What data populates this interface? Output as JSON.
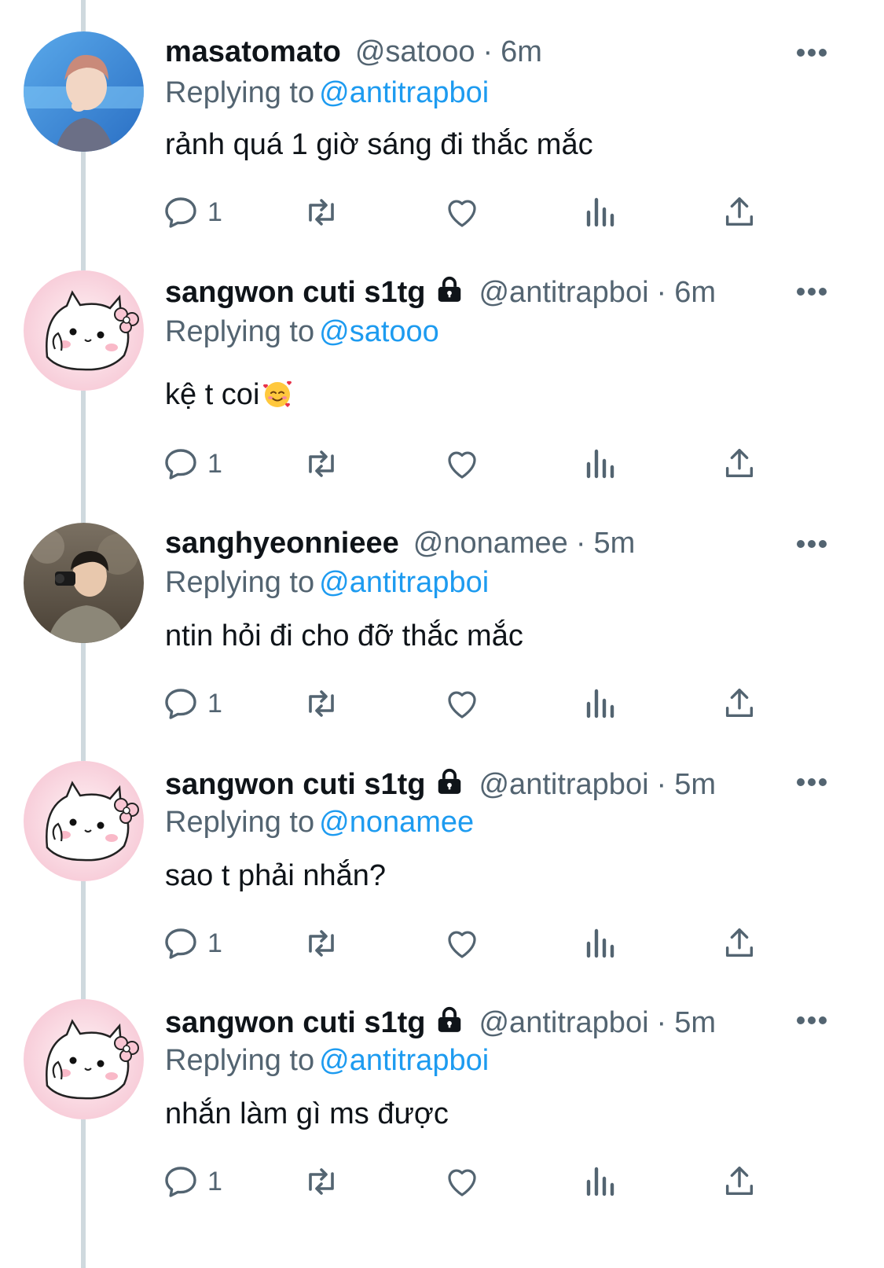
{
  "tweets": [
    {
      "display_name": "masatomato",
      "locked": false,
      "handle": "@satooo",
      "time": "6m",
      "replying_label": "Replying to",
      "reply_to": "@antitrapboi",
      "text": "rảnh quá 1 giờ sáng đi thắc mắc",
      "emoji": "",
      "avatar": "photo-avatar-blue",
      "reply_count": "1"
    },
    {
      "display_name": "sangwon cuti s1tg",
      "locked": true,
      "handle": "@antitrapboi",
      "time": "6m",
      "replying_label": "Replying to",
      "reply_to": "@satooo",
      "text": "kệ t coi",
      "emoji": "smiling-face-with-hearts",
      "avatar": "pink-cat-avatar",
      "reply_count": "1"
    },
    {
      "display_name": "sanghyeonnieee",
      "locked": false,
      "handle": "@nonamee",
      "time": "5m",
      "replying_label": "Replying to",
      "reply_to": "@antitrapboi",
      "text": "ntin hỏi đi cho đỡ thắc mắc",
      "emoji": "",
      "avatar": "photo-avatar-outdoor",
      "reply_count": "1"
    },
    {
      "display_name": "sangwon cuti s1tg",
      "locked": true,
      "handle": "@antitrapboi",
      "time": "5m",
      "replying_label": "Replying to",
      "reply_to": "@nonamee",
      "text": "sao t phải nhắn?",
      "emoji": "",
      "avatar": "pink-cat-avatar",
      "reply_count": "1"
    },
    {
      "display_name": "sangwon cuti s1tg",
      "locked": true,
      "handle": "@antitrapboi",
      "time": "5m",
      "replying_label": "Replying to",
      "reply_to": "@antitrapboi",
      "text": "nhắn làm gì ms được",
      "emoji": "",
      "avatar": "pink-cat-avatar",
      "reply_count": "1"
    }
  ],
  "icons": {
    "reply": "speech-bubble-icon",
    "retweet": "retweet-arrows-icon",
    "like": "heart-outline-icon",
    "views": "bar-chart-icon",
    "share": "upload-arrow-icon",
    "more": "three-dots-icon",
    "lock": "padlock-icon"
  },
  "colors": {
    "text": "#0f1419",
    "secondary": "#536471",
    "link": "#1d9bf0",
    "thread_line": "#cfd9de"
  },
  "separator": "·"
}
